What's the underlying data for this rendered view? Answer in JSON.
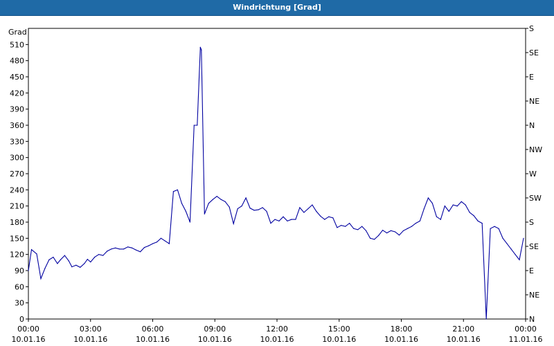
{
  "window": {
    "title": "Windrichtung [Grad]"
  },
  "chart_data": {
    "type": "line",
    "title": "Windrichtung [Grad]",
    "ylabel": "Grad",
    "xlabel": "",
    "ylim": [
      0,
      540
    ],
    "xlim_hours": [
      0,
      24
    ],
    "grid": true,
    "line_color": "#0000a0",
    "y_ticks": [
      0,
      30,
      60,
      90,
      120,
      150,
      180,
      210,
      240,
      270,
      300,
      330,
      360,
      390,
      420,
      450,
      480,
      510
    ],
    "right_axis_labels": [
      "N",
      "NE",
      "E",
      "SE",
      "S",
      "SW",
      "W",
      "NW",
      "N",
      "NE",
      "E",
      "SE",
      "S"
    ],
    "x_ticks": [
      {
        "time": "00:00",
        "date": "10.01.16"
      },
      {
        "time": "03:00",
        "date": "10.01.16"
      },
      {
        "time": "06:00",
        "date": "10.01.16"
      },
      {
        "time": "09:00",
        "date": "10.01.16"
      },
      {
        "time": "12:00",
        "date": "10.01.16"
      },
      {
        "time": "15:00",
        "date": "10.01.16"
      },
      {
        "time": "18:00",
        "date": "10.01.16"
      },
      {
        "time": "21:00",
        "date": "10.01.16"
      },
      {
        "time": "00:00",
        "date": "11.01.16"
      }
    ],
    "series": [
      {
        "x_hours": [
          0.0,
          0.15,
          0.4,
          0.6,
          0.8,
          1.0,
          1.2,
          1.4,
          1.55,
          1.75,
          1.95,
          2.1,
          2.3,
          2.5,
          2.7,
          2.85,
          3.0,
          3.2,
          3.4,
          3.6,
          3.8,
          4.0,
          4.2,
          4.4,
          4.6,
          4.8,
          5.0,
          5.2,
          5.4,
          5.6,
          5.8,
          6.0,
          6.2,
          6.4,
          6.6,
          6.8,
          7.0,
          7.2,
          7.4,
          7.6,
          7.8,
          8.0,
          8.15,
          8.3,
          8.35,
          8.5,
          8.7,
          8.9,
          9.1,
          9.3,
          9.5,
          9.7,
          9.9,
          10.1,
          10.3,
          10.5,
          10.7,
          10.9,
          11.1,
          11.3,
          11.5,
          11.7,
          11.9,
          12.1,
          12.3,
          12.5,
          12.7,
          12.9,
          13.1,
          13.3,
          13.5,
          13.7,
          13.9,
          14.1,
          14.3,
          14.5,
          14.7,
          14.9,
          15.1,
          15.3,
          15.5,
          15.7,
          15.9,
          16.1,
          16.3,
          16.5,
          16.7,
          16.9,
          17.1,
          17.3,
          17.5,
          17.7,
          17.9,
          18.1,
          18.3,
          18.5,
          18.7,
          18.9,
          19.1,
          19.3,
          19.5,
          19.7,
          19.9,
          20.1,
          20.3,
          20.5,
          20.7,
          20.9,
          21.1,
          21.3,
          21.5,
          21.7,
          21.9,
          22.1,
          22.3,
          22.5,
          22.7,
          22.9,
          23.1,
          23.3,
          23.5,
          23.7,
          23.9
        ],
        "values": [
          90,
          129,
          121,
          75,
          94,
          110,
          115,
          103,
          110,
          118,
          108,
          97,
          100,
          96,
          103,
          111,
          106,
          115,
          120,
          118,
          126,
          130,
          132,
          130,
          130,
          134,
          132,
          128,
          125,
          133,
          136,
          140,
          143,
          150,
          145,
          140,
          237,
          240,
          215,
          200,
          180,
          360,
          360,
          505,
          500,
          195,
          215,
          222,
          228,
          222,
          218,
          208,
          177,
          205,
          210,
          225,
          206,
          202,
          203,
          207,
          200,
          178,
          185,
          182,
          190,
          182,
          185,
          185,
          207,
          198,
          205,
          212,
          200,
          191,
          185,
          190,
          188,
          170,
          174,
          172,
          178,
          168,
          166,
          172,
          164,
          150,
          148,
          155,
          165,
          160,
          164,
          162,
          156,
          164,
          168,
          172,
          178,
          182,
          205,
          225,
          215,
          190,
          185,
          210,
          200,
          212,
          210,
          218,
          212,
          198,
          192,
          182,
          178,
          0,
          168,
          172,
          168,
          150,
          140,
          130,
          120,
          110,
          150
        ]
      }
    ]
  }
}
